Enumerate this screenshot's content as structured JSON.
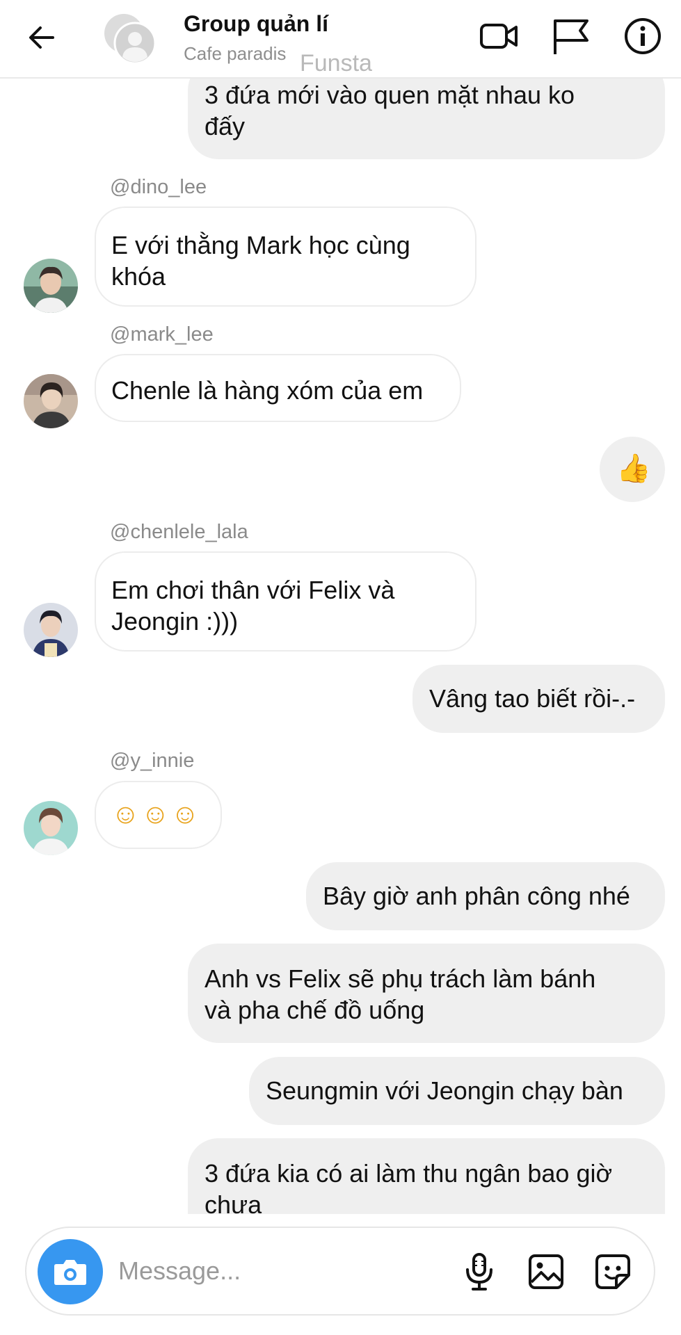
{
  "header": {
    "title": "Group quản lí",
    "subtitle": "Cafe paradis",
    "subtitle_tag": "Funsta"
  },
  "messages": {
    "m1": {
      "lines": [
        "3 đứa mới vào quen mặt nhau ko",
        "đấy"
      ]
    },
    "m2": {
      "username": "@dino_lee",
      "lines": [
        "E với thằng Mark học cùng",
        "khóa"
      ]
    },
    "m3": {
      "username": "@mark_lee",
      "lines": [
        "Chenle là hàng xóm của em"
      ]
    },
    "m4": {
      "emoji": "👍"
    },
    "m5": {
      "username": "@chenlele_lala",
      "lines": [
        "Em chơi thân với Felix và",
        "Jeongin :)))"
      ]
    },
    "m6": {
      "lines": [
        "Vâng tao biết rồi-.-"
      ]
    },
    "m7": {
      "username": "@y_innie",
      "lines": [
        "☺☺☺"
      ]
    },
    "m8": {
      "lines": [
        "Bây giờ anh phân công nhé"
      ]
    },
    "m9": {
      "lines": [
        "Anh vs Felix sẽ phụ trách làm bánh",
        "và pha chế đồ uống"
      ]
    },
    "m10": {
      "lines": [
        "Seungmin với Jeongin chạy bàn"
      ]
    },
    "m11": {
      "lines": [
        "3 đứa kia có ai làm thu ngân bao giờ",
        "chưa"
      ]
    }
  },
  "composer": {
    "placeholder": "Message..."
  },
  "icons": {
    "back": "arrow-left-icon",
    "video": "video-camera-icon",
    "report": "flag-icon",
    "info": "info-icon",
    "camera": "camera-icon",
    "mic": "microphone-icon",
    "gallery": "image-icon",
    "sticker": "sticker-icon"
  },
  "colors": {
    "my_bubble": "#efefef",
    "their_bubble_border": "#ececec",
    "camera_button": "#3797f0",
    "username_gray": "#8a8a8a"
  }
}
